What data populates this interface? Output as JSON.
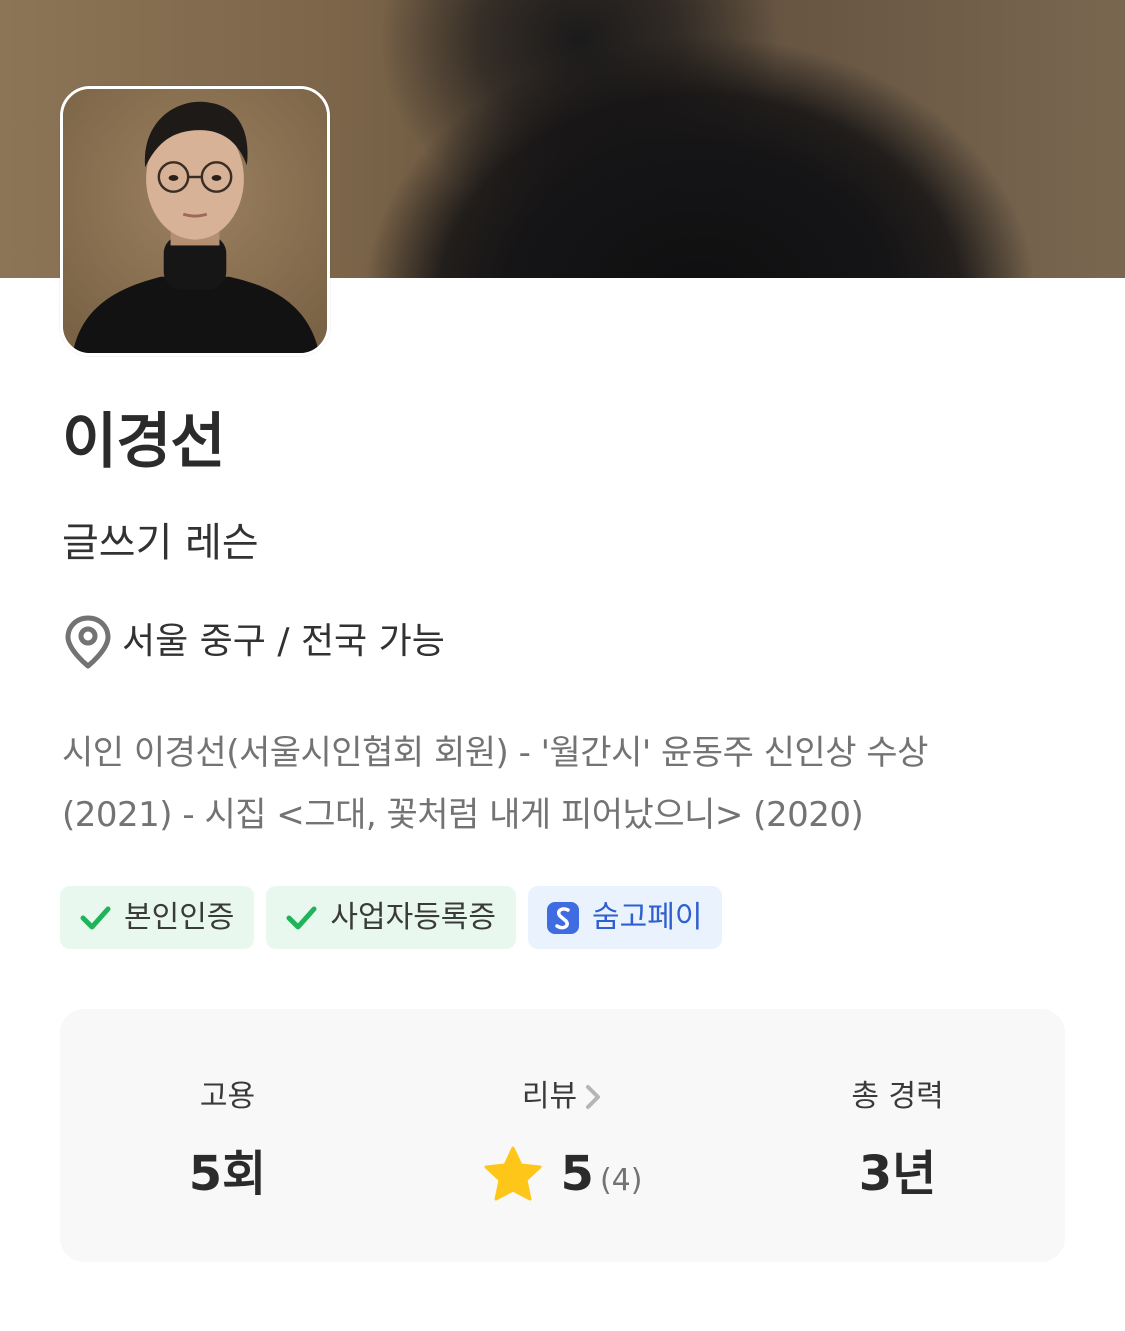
{
  "profile": {
    "name": "이경선",
    "category": "글쓰기 레슨",
    "location": "서울 중구 / 전국 가능",
    "intro_line1": "시인 이경선(서울시인협회 회원) - '월간시' 윤동주 신인상 수상",
    "intro_line2": "(2021)  - 시집 <그대, 꽃처럼 내게 피어났으니> (2020)"
  },
  "badges": [
    {
      "label": "본인인증",
      "icon": "check-icon",
      "color": "#1fb35a"
    },
    {
      "label": "사업자등록증",
      "icon": "check-icon",
      "color": "#1fb35a"
    },
    {
      "label": "숨고페이",
      "icon": "soomgo-pay-icon",
      "color": "#2f5fd0"
    }
  ],
  "stats": {
    "hire": {
      "label": "고용",
      "value": "5회"
    },
    "review": {
      "label": "리뷰",
      "rating": "5",
      "count": "(4)"
    },
    "career": {
      "label": "총 경력",
      "value": "3년"
    }
  },
  "colors": {
    "accent_green": "#1fb35a",
    "accent_blue": "#2f5fd0",
    "star": "#ffc61a",
    "stats_bg": "#f8f8f8"
  }
}
